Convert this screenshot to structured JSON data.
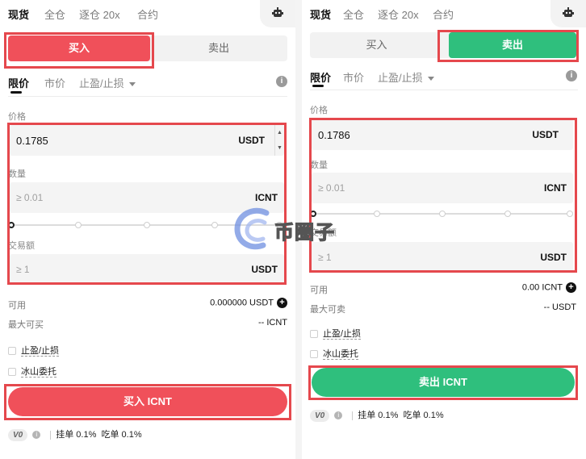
{
  "left": {
    "nav": [
      {
        "label": "现货",
        "active": true
      },
      {
        "label": "全仓",
        "active": false
      },
      {
        "label": "逐仓 20x",
        "active": false
      },
      {
        "label": "合约",
        "active": false
      }
    ],
    "side_tabs": {
      "buy": "买入",
      "sell": "卖出",
      "selected": "buy"
    },
    "order_tabs": [
      {
        "label": "限价",
        "active": true
      },
      {
        "label": "市价",
        "active": false
      },
      {
        "label": "止盈/止损",
        "active": false
      }
    ],
    "price": {
      "label": "价格",
      "value": "0.1785",
      "unit": "USDT"
    },
    "quantity": {
      "label": "数量",
      "placeholder": "≥ 0.01",
      "unit": "ICNT"
    },
    "amount": {
      "label": "交易额",
      "placeholder": "≥ 1",
      "unit": "USDT"
    },
    "available": {
      "label": "可用",
      "value": "0.000000 USDT"
    },
    "max": {
      "label": "最大可买",
      "value": "-- ICNT"
    },
    "options": [
      "止盈/止损",
      "冰山委托"
    ],
    "cta": "买入 ICNT",
    "fees": {
      "level": "V0",
      "maker": "挂单 0.1%",
      "taker": "吃单 0.1%"
    }
  },
  "right": {
    "nav": [
      {
        "label": "现货",
        "active": true
      },
      {
        "label": "全仓",
        "active": false
      },
      {
        "label": "逐仓 20x",
        "active": false
      },
      {
        "label": "合约",
        "active": false
      }
    ],
    "side_tabs": {
      "buy": "买入",
      "sell": "卖出",
      "selected": "sell"
    },
    "order_tabs": [
      {
        "label": "限价",
        "active": true
      },
      {
        "label": "市价",
        "active": false
      },
      {
        "label": "止盈/止损",
        "active": false
      }
    ],
    "price": {
      "label": "价格",
      "value": "0.1786",
      "unit": "USDT"
    },
    "quantity": {
      "label": "数量",
      "placeholder": "≥ 0.01",
      "unit": "ICNT"
    },
    "amount": {
      "label": "交易额",
      "placeholder": "≥ 1",
      "unit": "USDT"
    },
    "available": {
      "label": "可用",
      "value": "0.00 ICNT"
    },
    "max": {
      "label": "最大可卖",
      "value": "-- USDT"
    },
    "options": [
      "止盈/止损",
      "冰山委托"
    ],
    "cta": "卖出 ICNT",
    "fees": {
      "level": "V0",
      "maker": "挂单 0.1%",
      "taker": "吃单 0.1%"
    }
  },
  "watermark": {
    "text": "币圈子"
  },
  "colors": {
    "buy": "#f0505a",
    "sell": "#2fbf7d",
    "highlight": "#e5484d"
  },
  "icons": [
    "robot-icon",
    "info-icon",
    "add-icon",
    "help-icon",
    "checkbox-icon",
    "caret-down-icon"
  ]
}
